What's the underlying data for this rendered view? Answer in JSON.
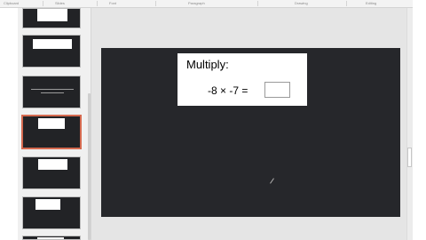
{
  "ribbon": {
    "groups": [
      "Clipboard",
      "Slides",
      "Font",
      "Paragraph",
      "Drawing",
      "Editing"
    ]
  },
  "thumbnails": [
    {
      "number": "",
      "selected": false
    },
    {
      "number": "",
      "selected": false
    },
    {
      "number": "",
      "selected": false
    },
    {
      "number": "",
      "selected": true
    },
    {
      "number": "",
      "selected": false
    },
    {
      "number": "",
      "selected": false
    },
    {
      "number": "",
      "selected": false
    }
  ],
  "slide": {
    "title": "Multiply:",
    "expression": "-8 × -7 =",
    "answer": ""
  },
  "colors": {
    "slide_background": "#26272b",
    "selected_thumbnail_border": "#d56a50"
  }
}
